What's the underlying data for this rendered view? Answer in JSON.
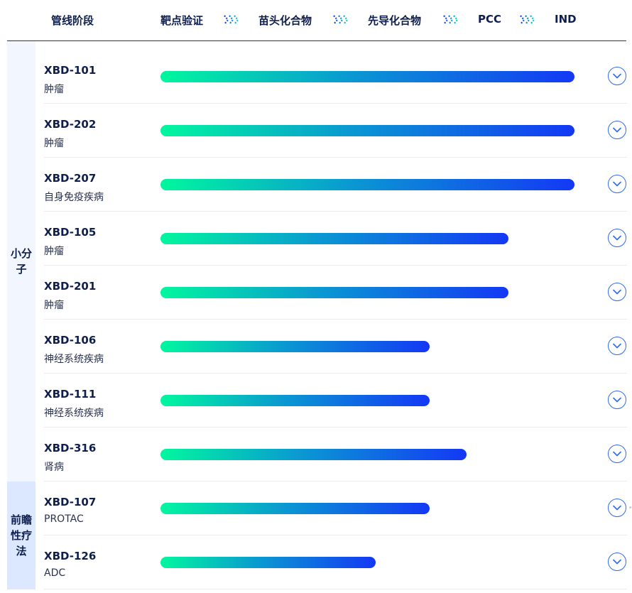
{
  "header": {
    "column_title": "管线阶段",
    "stages": [
      "靶点验证",
      "苗头化合物",
      "先导化合物",
      "PCC",
      "IND"
    ],
    "stage_arrow_icon": "triple-chevron-right-icon"
  },
  "categories": [
    {
      "label": "小分子"
    },
    {
      "label": "前瞻性疗法"
    }
  ],
  "rows": [
    {
      "code": "XBD-101",
      "indication": "肿瘤",
      "progress": 1.0
    },
    {
      "code": "XBD-202",
      "indication": "肿瘤",
      "progress": 1.0
    },
    {
      "code": "XBD-207",
      "indication": "自身免疫疾病",
      "progress": 1.0
    },
    {
      "code": "XBD-105",
      "indication": "肿瘤",
      "progress": 0.84
    },
    {
      "code": "XBD-201",
      "indication": "肿瘤",
      "progress": 0.84
    },
    {
      "code": "XBD-106",
      "indication": "神经系统疾病",
      "progress": 0.65
    },
    {
      "code": "XBD-111",
      "indication": "神经系统疾病",
      "progress": 0.65
    },
    {
      "code": "XBD-316",
      "indication": "肾病",
      "progress": 0.74
    },
    {
      "code": "XBD-107",
      "indication": "PROTAC",
      "progress": 0.65
    },
    {
      "code": "XBD-126",
      "indication": "ADC",
      "progress": 0.52
    }
  ],
  "expand_icon": "chevron-down-circle-icon",
  "colors": {
    "text": "#0e1f4d",
    "bar_start": "#00f79e",
    "bar_end": "#1438f5",
    "category_small_bg": "#f2f6ff",
    "category_front_bg": "#dce8ff",
    "toggle_border": "#2f6bf0"
  }
}
